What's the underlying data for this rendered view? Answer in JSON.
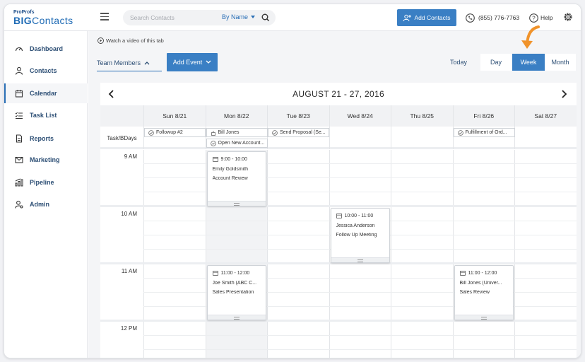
{
  "header": {
    "logo_small": "ProProfs",
    "logo_big_a": "BIG",
    "logo_big_b": "Contacts",
    "search_placeholder": "Search Contacts",
    "search_by": "By Name",
    "add_contacts": "Add Contacts",
    "phone": "(855) 776-7763",
    "help": "Help"
  },
  "sidebar": {
    "items": [
      {
        "label": "Dashboard",
        "icon": "dashboard-icon"
      },
      {
        "label": "Contacts",
        "icon": "contacts-icon"
      },
      {
        "label": "Calendar",
        "icon": "calendar-icon"
      },
      {
        "label": "Task List",
        "icon": "task-list-icon"
      },
      {
        "label": "Reports",
        "icon": "reports-icon"
      },
      {
        "label": "Marketing",
        "icon": "marketing-icon"
      },
      {
        "label": "Pipeline",
        "icon": "pipeline-icon"
      },
      {
        "label": "Admin",
        "icon": "admin-icon"
      }
    ],
    "active": "Calendar"
  },
  "toolbar": {
    "video_link": "Watch a video of this tab",
    "team_members": "Team Members",
    "add_event": "Add Event",
    "today": "Today",
    "views": [
      "Day",
      "Week",
      "Month"
    ],
    "active_view": "Week"
  },
  "calendar": {
    "range_title": "AUGUST 21 - 27, 2016",
    "days": [
      "Sun 8/21",
      "Mon 8/22",
      "Tue 8/23",
      "Wed 8/24",
      "Thu 8/25",
      "Fri 8/26",
      "Sat 8/27"
    ],
    "allday_label": "Task/BDays",
    "allday_items": [
      {
        "text": "Followup #2",
        "icon": "check-circle-icon"
      },
      {
        "text": "Bill Jones",
        "icon": "birthday-icon"
      },
      {
        "text": "Open New Account...",
        "icon": "check-circle-icon"
      },
      {
        "text": "Send Proposal (Se...",
        "icon": "check-circle-icon"
      },
      {
        "text": "Fulfillment of Ord...",
        "icon": "check-circle-icon"
      }
    ],
    "hours": [
      "9 AM",
      "10 AM",
      "11 AM",
      "12 PM"
    ],
    "events": [
      {
        "time": "9:00 - 10:00",
        "name": "Emily Goldsmith",
        "desc": "Account Review"
      },
      {
        "time": "10:00 - 11:00",
        "name": "Jessica Anderson",
        "desc": "Follow Up Meeting"
      },
      {
        "time": "11:00 - 12:00",
        "name": "Joe Smith (ABC C...",
        "desc": "Sales Presentation"
      },
      {
        "time": "11:00 - 12:00",
        "name": "Bill Jones (Univer...",
        "desc": "Sales Review"
      }
    ]
  },
  "colors": {
    "accent": "#3a7fc4",
    "highlight_arrow": "#f0932b",
    "nav_text": "#2d4f75"
  }
}
